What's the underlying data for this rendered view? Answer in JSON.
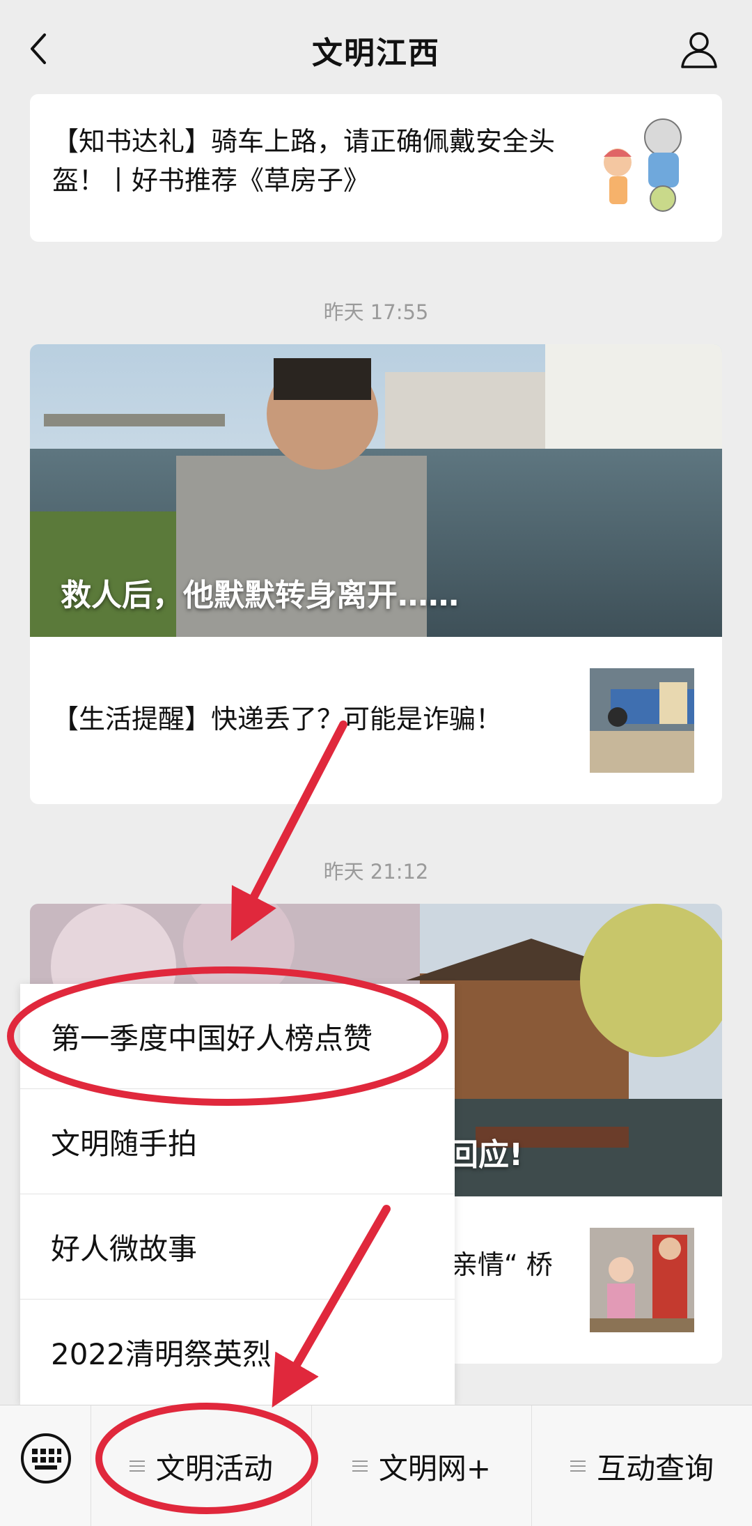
{
  "header": {
    "title": "文明江西"
  },
  "feed": {
    "first_card": {
      "title": "【知书达礼】骑车上路，请正确佩戴安全头盔！丨好书推荐《草房子》"
    },
    "group1": {
      "time": "昨天 17:55",
      "cover_title": "救人后，他默默转身离开……",
      "item_title": "【生活提醒】快递丢了？可能是诈骗！"
    },
    "group2": {
      "time": "昨天 21:12",
      "cover_title_partial": "回应!",
      "item_title_partial": "亲情“ 桥"
    }
  },
  "menu": {
    "items": [
      {
        "label": "第一季度中国好人榜点赞"
      },
      {
        "label": "文明随手拍"
      },
      {
        "label": "好人微故事"
      },
      {
        "label": "2022清明祭英烈"
      }
    ]
  },
  "bottom_bar": {
    "keyboard_icon": "keyboard-icon",
    "tabs": [
      {
        "label": "文明活动"
      },
      {
        "label": "文明网+"
      },
      {
        "label": "互动查询"
      }
    ]
  },
  "colors": {
    "annotation": "#e0283c",
    "background": "#ededed",
    "text": "#111111",
    "timestamp": "#9a9a9a"
  }
}
